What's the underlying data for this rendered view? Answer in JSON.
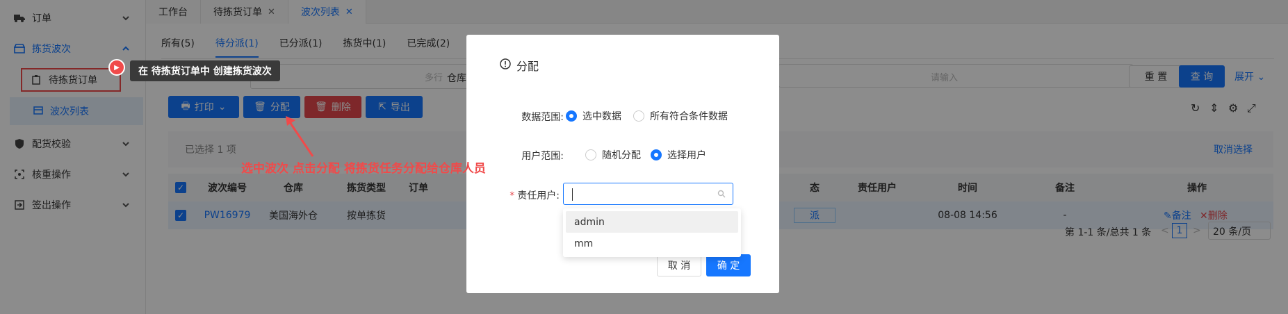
{
  "sidebar": {
    "items": [
      {
        "label": "订单",
        "icon": "truck-icon"
      },
      {
        "label": "拣货波次",
        "icon": "box-icon"
      },
      {
        "label": "待拣货订单",
        "icon": "clipboard-icon"
      },
      {
        "label": "波次列表",
        "icon": "list-icon"
      },
      {
        "label": "配货校验",
        "icon": "shield-icon"
      },
      {
        "label": "核重操作",
        "icon": "scan-icon"
      },
      {
        "label": "签出操作",
        "icon": "export-icon"
      }
    ]
  },
  "top_tabs": [
    {
      "label": "工作台"
    },
    {
      "label": "待拣货订单",
      "close": "✕"
    },
    {
      "label": "波次列表",
      "close": "✕"
    }
  ],
  "status_tabs": [
    "所有(5)",
    "待分派(1)",
    "已分派(1)",
    "拣货中(1)",
    "已完成(2)"
  ],
  "filters": {
    "textarea_placeholder": "多行",
    "warehouse_label": "仓库",
    "input_placeholder": "请输入",
    "reset": "重 置",
    "search": "查 询",
    "expand": "展开"
  },
  "toolbar": {
    "print": "打印",
    "assign": "分配",
    "delete": "删除",
    "export": "导出"
  },
  "selection": {
    "text": "已选择  1  项",
    "cancel": "取消选择"
  },
  "table": {
    "headers": [
      "波次编号",
      "仓库",
      "拣货类型",
      "订单",
      "态",
      "责任用户",
      "时间",
      "备注",
      "操作"
    ],
    "row": {
      "id": "PW16979",
      "warehouse": "美国海外仓",
      "type": "按单拣货",
      "order": "",
      "status": "派",
      "user": "",
      "time": "08-08 14:56",
      "note": "-",
      "action_note": "备注",
      "action_delete": "删除"
    }
  },
  "pager": {
    "summary": "第 1-1 条/总共 1 条",
    "prev": "<",
    "page": "1",
    "next": ">",
    "size": "20 条/页"
  },
  "modal": {
    "title": "分配",
    "data_scope_label": "数据范围:",
    "data_scope_options": [
      "选中数据",
      "所有符合条件数据"
    ],
    "user_scope_label": "用户范围:",
    "user_scope_options": [
      "随机分配",
      "选择用户"
    ],
    "responsible_label": "责任用户:",
    "required_mark": "*",
    "options": [
      "admin",
      "mm"
    ],
    "cancel": "取 消",
    "confirm": "确 定"
  },
  "annotations": {
    "tooltip": "在 待拣货订单中 创建拣货波次",
    "instruction": "选中波次 点击分配 将拣货任务分配给仓库人员"
  },
  "colors": {
    "primary": "#1677ff",
    "danger": "#e5484d",
    "annotation": "#f04a4a"
  }
}
